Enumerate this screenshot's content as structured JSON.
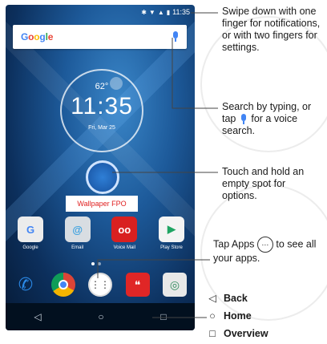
{
  "phone": {
    "status_time": "11:35",
    "search_logo": "Google",
    "clock_temp": "62°",
    "clock_time": "11:35",
    "clock_date": "Fri, Mar 25",
    "wallpaper_label": "Wallpaper FPO",
    "apps": [
      {
        "label": "Google",
        "icon": "google-icon",
        "glyph": "G",
        "color": "#e8e8e8"
      },
      {
        "label": "Email",
        "icon": "email-icon",
        "glyph": "@",
        "color": "#3aa0e0"
      },
      {
        "label": "Voice Mail",
        "icon": "voicemail-icon",
        "glyph": "oo",
        "color": "#d92020"
      },
      {
        "label": "Play Store",
        "icon": "play-store-icon",
        "glyph": "▶",
        "color": "#f0f0f0"
      }
    ],
    "dock": [
      {
        "icon": "phone-icon",
        "glyph": "✆",
        "color": "#2b7de0"
      },
      {
        "icon": "chrome-icon",
        "glyph": "◉",
        "color": "#e8b020"
      },
      {
        "icon": "apps-icon",
        "glyph": "⋯",
        "color": "#ffffff"
      },
      {
        "icon": "messaging-icon",
        "glyph": "❝",
        "color": "#e02626"
      },
      {
        "icon": "camera-icon",
        "glyph": "◎",
        "color": "#e8e8e8"
      }
    ],
    "nav": {
      "back": "◁",
      "home": "○",
      "overview": "□"
    }
  },
  "callouts": {
    "swipe": "Swipe down with one finger for notifications, or with two fingers for settings.",
    "search_a": "Search by typing, or tap",
    "search_b": "for a voice search.",
    "touch": "Touch and hold an empty spot for options.",
    "apps_a": "Tap Apps",
    "apps_b": "to see all your apps."
  },
  "legend": {
    "back": "Back",
    "home": "Home",
    "overview": "Overview"
  }
}
